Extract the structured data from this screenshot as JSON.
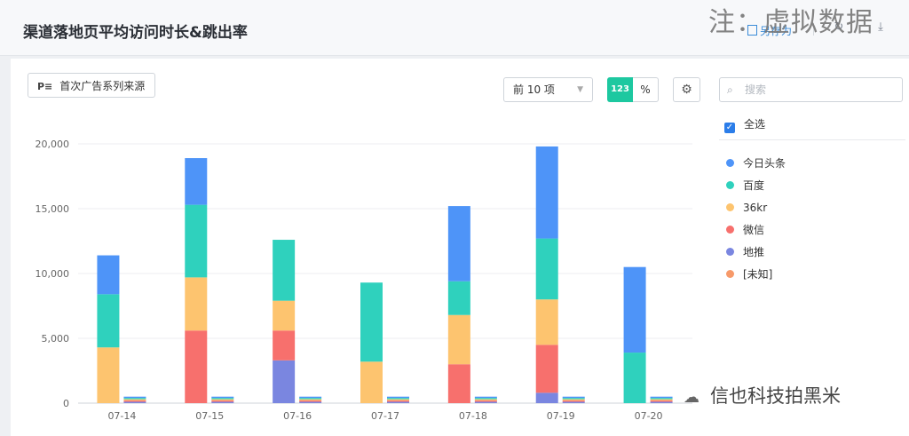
{
  "header": {
    "title": "渠道落地页平均访问时长&跳出率",
    "save_as": "另存为"
  },
  "watermarks": {
    "top": "注：虚拟数据",
    "bottom": "信也科技拍黑米"
  },
  "toolbar": {
    "dimension_label": "首次广告系列来源",
    "topn_value": "前 10 项",
    "num_toggle_label": "123",
    "pct_toggle_label": "%",
    "search_placeholder": "搜索",
    "select_all_label": "全选"
  },
  "colors": {
    "accent": "#1dc8a0",
    "今日头条": "#4e94f8",
    "百度": "#2fd1bd",
    "36kr": "#fdc46f",
    "微信": "#f7706d",
    "地推": "#7a86e0",
    "[未知]": "#f79a6a"
  },
  "chart_data": {
    "type": "bar",
    "stacked": true,
    "categories": [
      "07-14",
      "07-15",
      "07-16",
      "07-17",
      "07-18",
      "07-19",
      "07-20"
    ],
    "series": [
      {
        "name": "地推",
        "values": [
          0,
          0,
          3300,
          0,
          0,
          800,
          0
        ]
      },
      {
        "name": "微信",
        "values": [
          0,
          5600,
          2300,
          0,
          3000,
          3700,
          0
        ]
      },
      {
        "name": "36kr",
        "values": [
          4300,
          4100,
          2300,
          3200,
          3800,
          3500,
          0
        ]
      },
      {
        "name": "百度",
        "values": [
          4100,
          5600,
          4700,
          6100,
          2600,
          4700,
          3900
        ]
      },
      {
        "name": "今日头条",
        "values": [
          3000,
          3600,
          0,
          0,
          5800,
          7100,
          6600
        ]
      },
      {
        "name": "[未知]",
        "values": [
          0,
          0,
          0,
          0,
          0,
          0,
          0
        ]
      }
    ],
    "secondary_bar_values": [
      500,
      500,
      500,
      500,
      500,
      500,
      500
    ],
    "y_ticks": [
      "0",
      "5,000",
      "10,000",
      "15,000",
      "20,000"
    ],
    "ylim": [
      0,
      20000
    ],
    "legend_order": [
      "今日头条",
      "百度",
      "36kr",
      "微信",
      "地推",
      "[未知]"
    ],
    "legend_position": "right",
    "grid": true
  }
}
